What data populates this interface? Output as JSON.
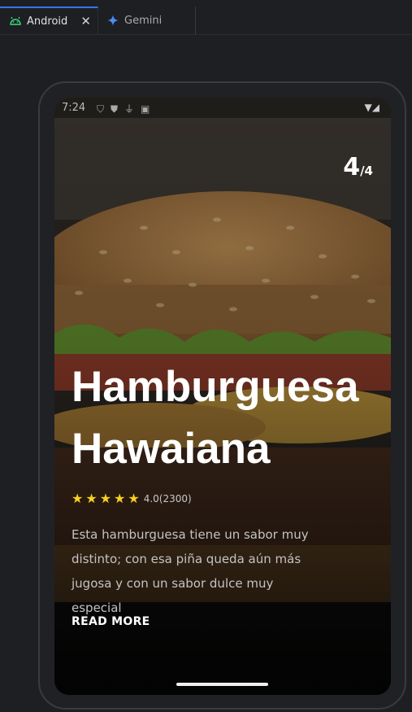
{
  "tabs": [
    {
      "label": "Android",
      "icon": "android-icon",
      "active": true,
      "close": "✕"
    },
    {
      "label": "Gemini",
      "icon": "gemini-sparkle-icon",
      "active": false
    }
  ],
  "status_bar": {
    "time": "7:24",
    "icons": [
      "shield-icon",
      "shield-badge-icon",
      "usb-icon",
      "sim-icon"
    ],
    "right_icons": [
      "wifi-icon",
      "signal-icon"
    ]
  },
  "app": {
    "counter": {
      "current": "4",
      "total": "/4"
    },
    "title_line1": "Hamburguesa",
    "title_line2": "Hawaiana",
    "rating": {
      "stars": 5,
      "text": "4.0(2300)"
    },
    "description": "Esta hamburguesa tiene un sabor muy distinto; con esa piña queda aún más jugosa y con un sabor dulce muy especial",
    "read_more": "READ MORE"
  },
  "colors": {
    "accent": "#3574f0",
    "star": "#f7d11d",
    "gemini": "#4a8cf7",
    "android": "#3ddc84"
  }
}
